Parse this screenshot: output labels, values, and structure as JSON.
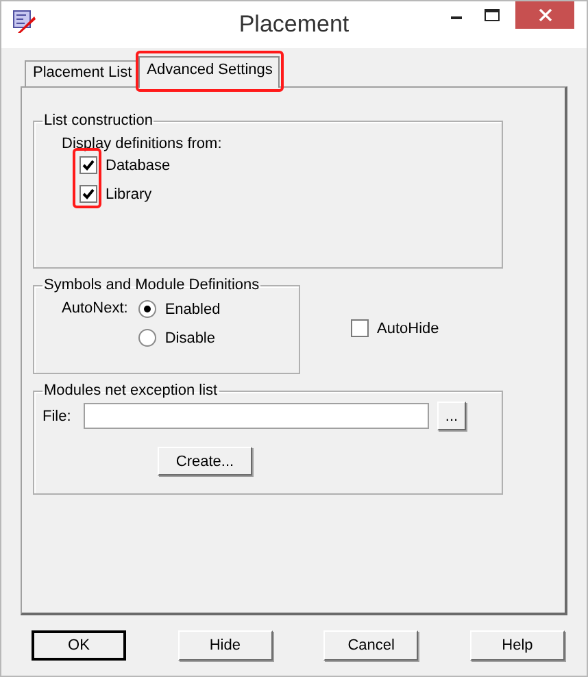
{
  "window": {
    "title": "Placement"
  },
  "tabs": [
    {
      "label": "Placement List",
      "selected": false,
      "highlighted": false
    },
    {
      "label": "Advanced Settings",
      "selected": true,
      "highlighted": true
    }
  ],
  "list_construction": {
    "title": "List construction",
    "caption": "Display definitions from:",
    "highlighted": true,
    "checkboxes": [
      {
        "label": "Database",
        "checked": true
      },
      {
        "label": "Library",
        "checked": true
      }
    ]
  },
  "symbols": {
    "title": "Symbols and Module Definitions",
    "autonext_label": "AutoNext:",
    "radios": [
      {
        "label": "Enabled",
        "selected": true
      },
      {
        "label": "Disable",
        "selected": false
      }
    ]
  },
  "autohide": {
    "label": "AutoHide",
    "checked": false
  },
  "modules": {
    "title": "Modules net exception list",
    "file_label": "File:",
    "browse_button": "...",
    "create_button": "Create..."
  },
  "buttons": [
    {
      "label": "OK",
      "default": true
    },
    {
      "label": "Hide",
      "default": false
    },
    {
      "label": "Cancel",
      "default": false
    },
    {
      "label": "Help",
      "default": false
    }
  ]
}
